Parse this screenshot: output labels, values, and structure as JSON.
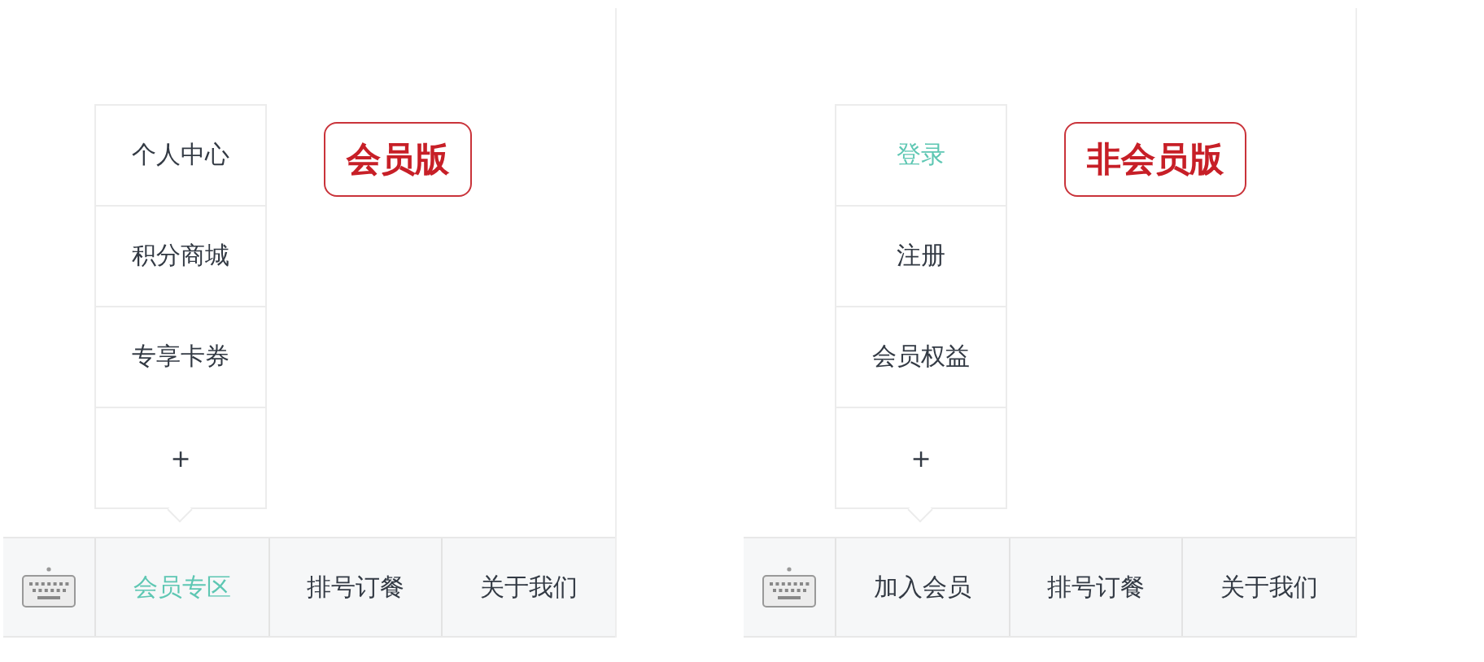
{
  "panels": [
    {
      "badge": "会员版",
      "submenu": [
        {
          "label": "个人中心",
          "selected": false
        },
        {
          "label": "积分商城",
          "selected": false
        },
        {
          "label": "专享卡券",
          "selected": false
        },
        {
          "label": "+",
          "selected": false
        }
      ],
      "menu": [
        {
          "label": "会员专区",
          "selected": true
        },
        {
          "label": "排号订餐",
          "selected": false
        },
        {
          "label": "关于我们",
          "selected": false
        }
      ]
    },
    {
      "badge": "非会员版",
      "submenu": [
        {
          "label": "登录",
          "selected": true
        },
        {
          "label": "注册",
          "selected": false
        },
        {
          "label": "会员权益",
          "selected": false
        },
        {
          "label": "+",
          "selected": false
        }
      ],
      "menu": [
        {
          "label": "加入会员",
          "selected": false
        },
        {
          "label": "排号订餐",
          "selected": false
        },
        {
          "label": "关于我们",
          "selected": false
        }
      ]
    }
  ]
}
